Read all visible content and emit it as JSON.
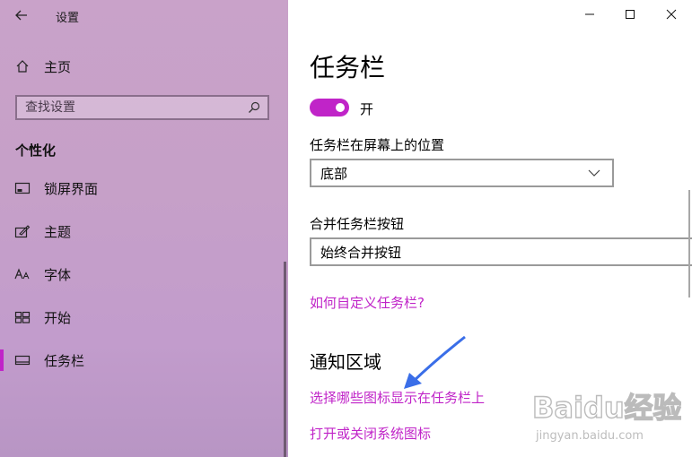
{
  "window": {
    "title": "设置",
    "controls": {
      "minimize": "minimize",
      "maximize": "maximize",
      "close": "close"
    }
  },
  "sidebar": {
    "home_label": "主页",
    "search_placeholder": "查找设置",
    "section_heading": "个性化",
    "items": [
      {
        "label": "锁屏界面",
        "icon": "lock-screen-icon",
        "selected": false
      },
      {
        "label": "主题",
        "icon": "theme-brush-icon",
        "selected": false
      },
      {
        "label": "字体",
        "icon": "font-icon",
        "selected": false
      },
      {
        "label": "开始",
        "icon": "start-grid-icon",
        "selected": false
      },
      {
        "label": "任务栏",
        "icon": "taskbar-icon",
        "selected": true
      }
    ]
  },
  "main": {
    "page_title": "任务栏",
    "toggle": {
      "state_label": "开",
      "on": true
    },
    "position": {
      "label": "任务栏在屏幕上的位置",
      "value": "底部"
    },
    "combine": {
      "label": "合并任务栏按钮",
      "value": "始终合并按钮"
    },
    "help_link": "如何自定义任务栏?",
    "notification": {
      "heading": "通知区域",
      "link_icons": "选择哪些图标显示在任务栏上",
      "link_system": "打开或关闭系统图标"
    }
  },
  "watermark": {
    "brand": "Baidu经验",
    "url": "jingyan.baidu.com"
  },
  "colors": {
    "accent": "#c024c8",
    "sidebar_bg": "#c6a0c8",
    "arrow": "#3a6ee8"
  }
}
